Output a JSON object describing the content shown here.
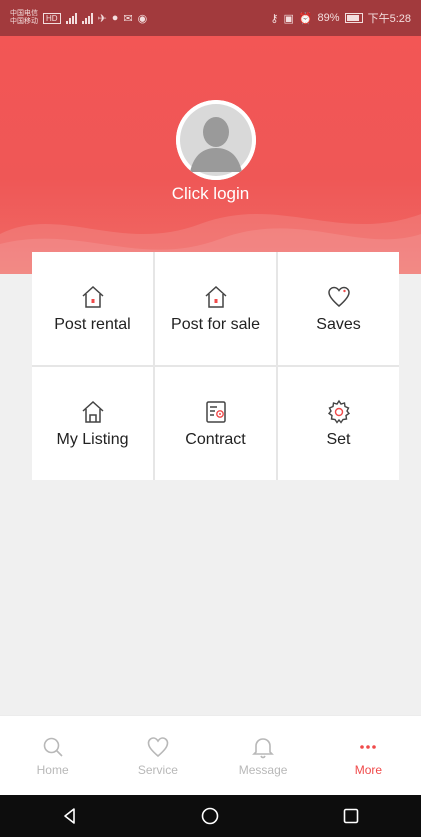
{
  "status_bar": {
    "carrier_line1": "中国电信",
    "carrier_line2": "中国移动",
    "network_badge": "HD",
    "battery_percent": "89%",
    "time": "下午5:28"
  },
  "header": {
    "login_label": "Click login"
  },
  "grid": {
    "items": [
      {
        "label": "Post rental",
        "icon": "house-icon"
      },
      {
        "label": "Post for sale",
        "icon": "house-icon"
      },
      {
        "label": "Saves",
        "icon": "heart-icon"
      },
      {
        "label": "My Listing",
        "icon": "house-outline-icon"
      },
      {
        "label": "Contract",
        "icon": "contract-icon"
      },
      {
        "label": "Set",
        "icon": "gear-icon"
      }
    ]
  },
  "tabbar": {
    "tabs": [
      {
        "label": "Home",
        "icon": "search-icon",
        "active": false
      },
      {
        "label": "Service",
        "icon": "heart-icon",
        "active": false
      },
      {
        "label": "Message",
        "icon": "bell-icon",
        "active": false
      },
      {
        "label": "More",
        "icon": "dots-icon",
        "active": true
      }
    ]
  },
  "colors": {
    "accent": "#f04a4a",
    "header_red": "#f35655",
    "status_bar": "#a23a3d",
    "inactive": "#b8b8b8"
  }
}
